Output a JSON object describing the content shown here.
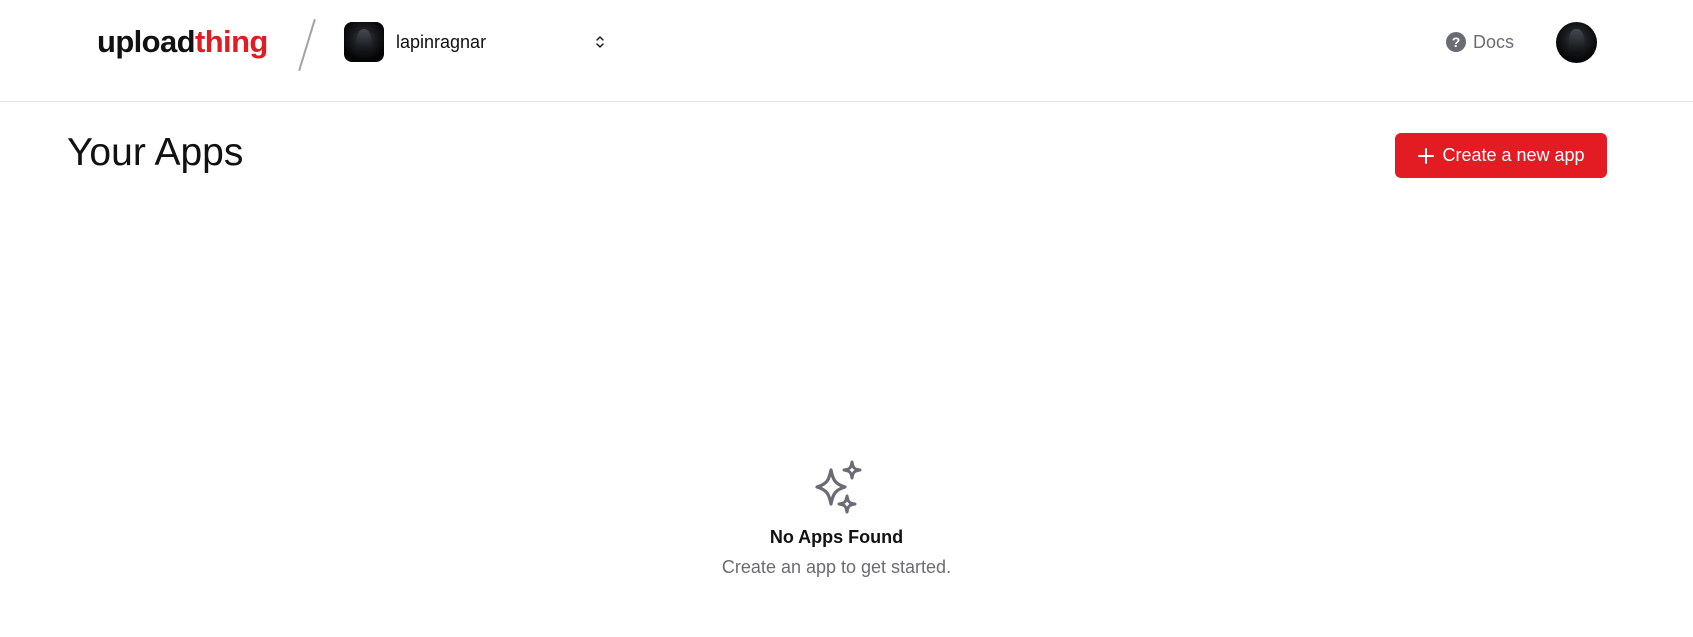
{
  "header": {
    "logo_part1": "upload",
    "logo_part2": "thing",
    "team_name": "lapinragnar",
    "docs_label": "Docs"
  },
  "main": {
    "title": "Your Apps",
    "create_label": "Create a new app",
    "empty_title": "No Apps Found",
    "empty_subtitle": "Create an app to get started."
  },
  "colors": {
    "brand_red": "#e31b23",
    "muted_gray": "#6b6b73"
  },
  "icons": {
    "team_switch": "chevron-up-down-icon",
    "docs": "question-circle-icon",
    "create": "plus-icon",
    "empty_state": "sparkles-icon"
  }
}
